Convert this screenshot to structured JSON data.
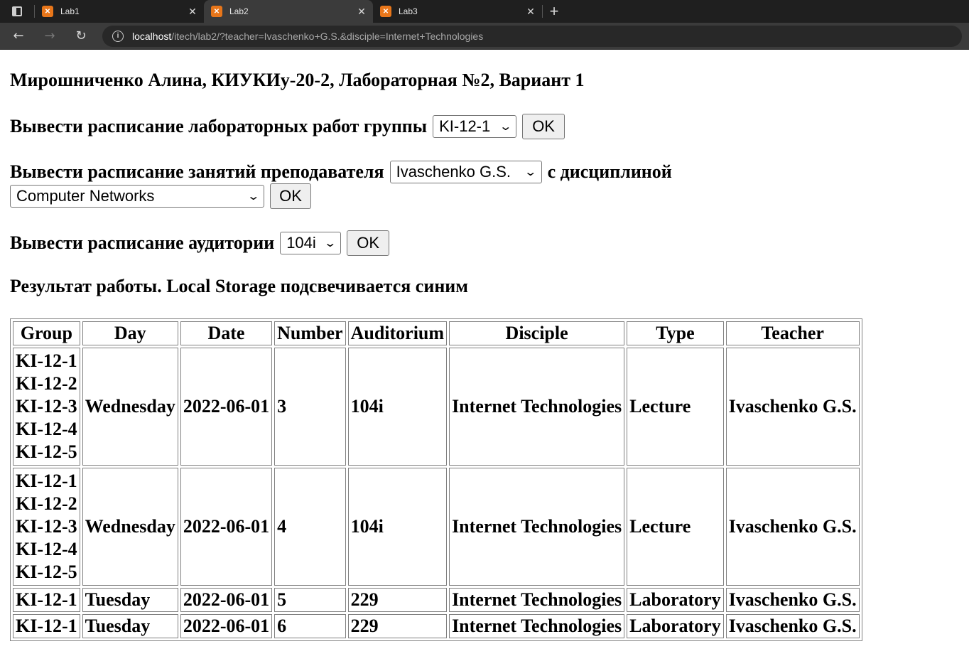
{
  "browser": {
    "tabs": [
      {
        "title": "Lab1",
        "active": false
      },
      {
        "title": "Lab2",
        "active": true
      },
      {
        "title": "Lab3",
        "active": false
      }
    ],
    "url_host": "localhost",
    "url_path": "/itech/lab2/?teacher=Ivaschenko+G.S.&disciple=Internet+Technologies"
  },
  "page": {
    "title": "Мирошниченко Алина, КИУКИу-20-2, Лабораторная №2, Вариант 1",
    "group_form": {
      "label": "Вывести расписание лабораторных работ группы",
      "selected": "KI-12-1",
      "button": "OK"
    },
    "teacher_form": {
      "label": "Вывести расписание занятий преподавателя",
      "selected_teacher": "Ivaschenko G.S.",
      "mid_label": "с дисциплиной",
      "selected_disciple": "Computer Networks",
      "button": "OK"
    },
    "auditorium_form": {
      "label": "Вывести расписание аудитории",
      "selected": "104i",
      "button": "OK"
    },
    "result_heading": "Результат работы. Local Storage подсвечивается синим"
  },
  "table": {
    "headers": [
      "Group",
      "Day",
      "Date",
      "Number",
      "Auditorium",
      "Disciple",
      "Type",
      "Teacher"
    ],
    "rows": [
      {
        "groups": [
          "KI-12-1",
          "KI-12-2",
          "KI-12-3",
          "KI-12-4",
          "KI-12-5"
        ],
        "day": "Wednesday",
        "date": "2022-06-01",
        "number": "3",
        "auditorium": "104i",
        "disciple": "Internet Technologies",
        "type": "Lecture",
        "teacher": "Ivaschenko G.S."
      },
      {
        "groups": [
          "KI-12-1",
          "KI-12-2",
          "KI-12-3",
          "KI-12-4",
          "KI-12-5"
        ],
        "day": "Wednesday",
        "date": "2022-06-01",
        "number": "4",
        "auditorium": "104i",
        "disciple": "Internet Technologies",
        "type": "Lecture",
        "teacher": "Ivaschenko G.S."
      },
      {
        "groups": [
          "KI-12-1"
        ],
        "day": "Tuesday",
        "date": "2022-06-01",
        "number": "5",
        "auditorium": "229",
        "disciple": "Internet Technologies",
        "type": "Laboratory",
        "teacher": "Ivaschenko G.S."
      },
      {
        "groups": [
          "KI-12-1"
        ],
        "day": "Tuesday",
        "date": "2022-06-01",
        "number": "6",
        "auditorium": "229",
        "disciple": "Internet Technologies",
        "type": "Laboratory",
        "teacher": "Ivaschenko G.S."
      }
    ]
  }
}
